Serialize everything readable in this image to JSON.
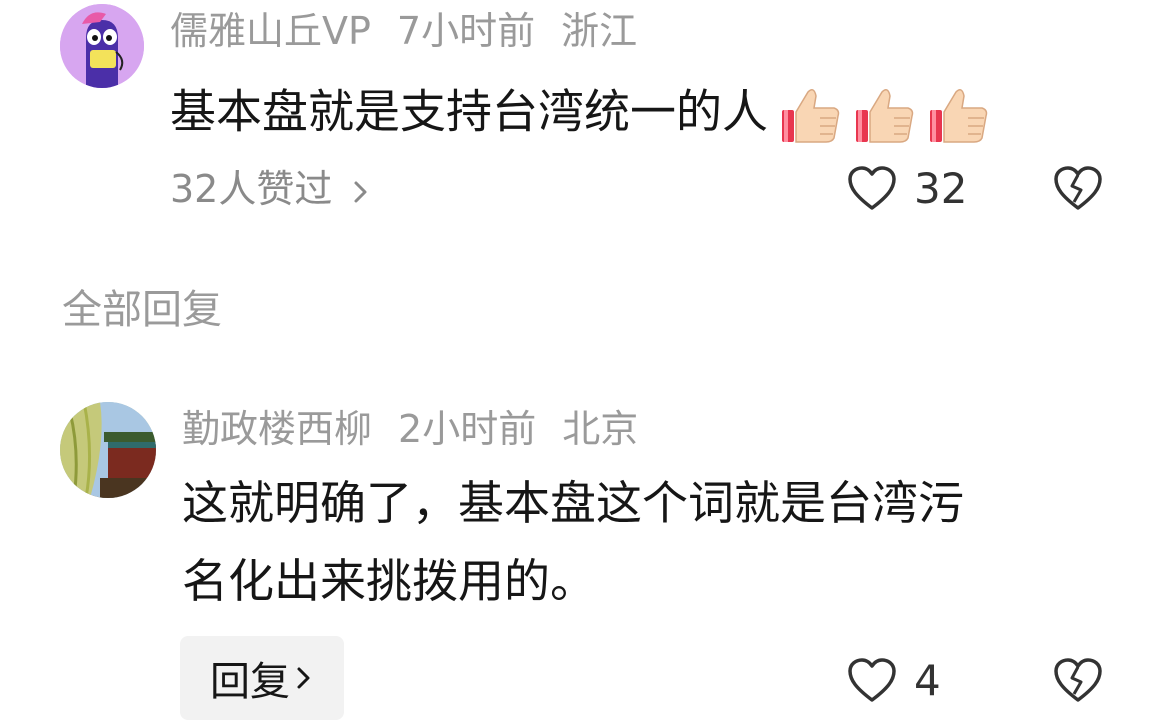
{
  "comment_1": {
    "username": "儒雅山丘VP",
    "time": "7小时前",
    "location": "浙江",
    "text": "基本盘就是支持台湾统一的人",
    "emojis": [
      "thumbs-up-icon",
      "thumbs-up-icon",
      "thumbs-up-icon"
    ],
    "liked_by": "32人赞过",
    "like_count": "32"
  },
  "section_title": "全部回复",
  "comment_2": {
    "username": "勤政楼西柳",
    "time": "2小时前",
    "location": "北京",
    "text_line1": "这就明确了，基本盘这个词就是台湾污",
    "text_line2": "名化出来挑拨用的。",
    "reply_label": "回复",
    "like_count": "4"
  },
  "colors": {
    "meta_gray": "#9a9a9a",
    "text_dark": "#161616",
    "avatar1_bg": "#d7a6f0"
  }
}
